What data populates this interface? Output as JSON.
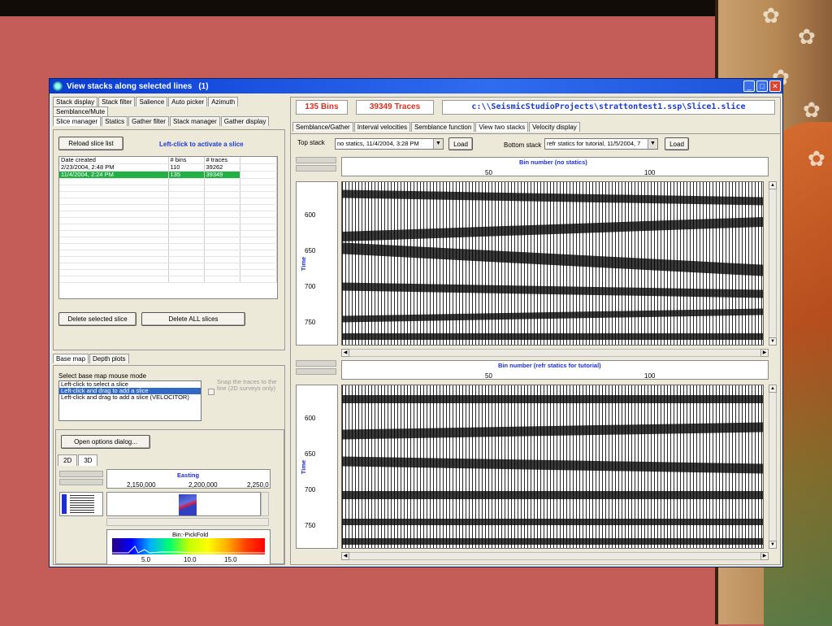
{
  "window": {
    "title": "View stacks along selected lines",
    "instance": "(1)"
  },
  "left_top": {
    "tabs_row1": [
      "Stack display",
      "Stack filter",
      "Salience",
      "Auto picker",
      "Azimuth",
      "Semblance/Mute"
    ],
    "tabs_row2": [
      "Slice manager",
      "Statics",
      "Gather filter",
      "Stack manager",
      "Gather display"
    ],
    "reload_label": "Reload slice list",
    "hint": "Left-click to activate a slice",
    "grid": {
      "headers": [
        "Date created",
        "# bins",
        "# traces"
      ],
      "rows": [
        [
          "2/23/2004, 2:48 PM",
          "110",
          "39262"
        ],
        [
          "11/4/2004, 2:24 PM",
          "135",
          "39349"
        ]
      ]
    },
    "delete_selected": "Delete selected slice",
    "delete_all": "Delete ALL slices"
  },
  "left_bottom": {
    "tabs": [
      "Base map",
      "Depth plots"
    ],
    "mode_label": "Select base map mouse mode",
    "modes": [
      "Left-click to select a slice",
      "Left-click and drag to add a slice",
      "Left-click and drag to add a slice (VELOCITOR)"
    ],
    "snap_label": "Snap the traces to the line (2D surveys only)",
    "open_options": "Open options dialog...",
    "view_tabs": [
      "2D",
      "3D"
    ],
    "easting_title": "Easting",
    "easting_ticks": [
      "2,150,000",
      "2,200,000",
      "2,250,0"
    ],
    "colorbar_title": "Bin:-PickFold",
    "colorbar_ticks": [
      "5.0",
      "10.0",
      "15.0"
    ]
  },
  "right": {
    "bins": "135 Bins",
    "traces": "39349 Traces",
    "path": "c:\\\\SeismicStudioProjects\\strattontest1.ssp\\Slice1.slice",
    "tabs": [
      "Semblance/Gather",
      "Interval velocities",
      "Semblance function",
      "View two stacks",
      "Velocity display"
    ],
    "top_stack_label": "Top stack",
    "top_stack_value": "no statics, 11/4/2004, 3:28 PM",
    "bottom_stack_label": "Bottom stack",
    "bottom_stack_value": "refr statics for tutorial, 11/5/2004, 7",
    "load": "Load",
    "top_plot": {
      "title": "Bin number  (no statics)",
      "xticks": [
        "50",
        "100"
      ],
      "ylabel": "Time",
      "yticks": [
        "600",
        "650",
        "700",
        "750"
      ]
    },
    "bottom_plot": {
      "title": "Bin number  (refr statics for tutorial)",
      "xticks": [
        "50",
        "100"
      ],
      "ylabel": "Time",
      "yticks": [
        "600",
        "650",
        "700",
        "750"
      ]
    }
  }
}
